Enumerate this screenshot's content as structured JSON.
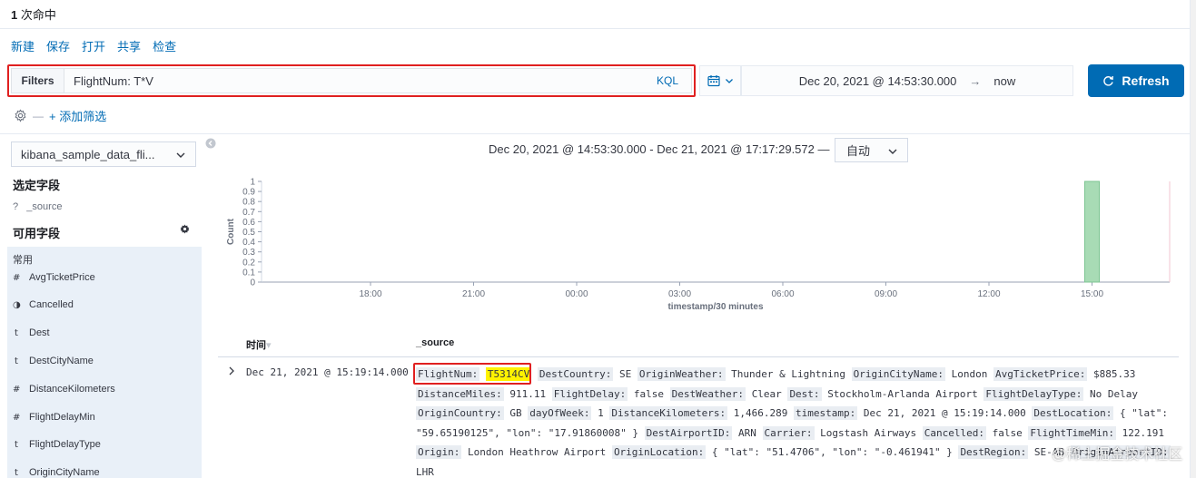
{
  "hits": {
    "count": "1",
    "label": "次命中"
  },
  "menu": {
    "new": "新建",
    "save": "保存",
    "open": "打开",
    "share": "共享",
    "inspect": "检查"
  },
  "query": {
    "filters_label": "Filters",
    "value": "FlightNum: T*V",
    "language": "KQL"
  },
  "time": {
    "start": "Dec 20, 2021 @ 14:53:30.000",
    "end": "now",
    "refresh_label": "Refresh"
  },
  "filter_bar": {
    "dash": "—",
    "add_filter": "+ 添加筛选"
  },
  "sidebar": {
    "index_pattern": "kibana_sample_data_fli...",
    "selected_title": "选定字段",
    "selected_field": {
      "type": "?",
      "name": "_source"
    },
    "available_title": "可用字段",
    "common_label": "常用",
    "fields": [
      {
        "type": "#",
        "name": "AvgTicketPrice"
      },
      {
        "type": "◑",
        "name": "Cancelled"
      },
      {
        "type": "t",
        "name": "Dest"
      },
      {
        "type": "t",
        "name": "DestCityName"
      },
      {
        "type": "#",
        "name": "DistanceKilometers"
      },
      {
        "type": "#",
        "name": "FlightDelayMin"
      },
      {
        "type": "t",
        "name": "FlightDelayType"
      },
      {
        "type": "t",
        "name": "OriginCityName"
      }
    ]
  },
  "histogram": {
    "range_label": "Dec 20, 2021 @ 14:53:30.000 - Dec 21, 2021 @ 17:17:29.572 —",
    "interval": "自动"
  },
  "chart_data": {
    "type": "bar",
    "title": "",
    "xlabel": "timestamp/30 minutes",
    "ylabel": "Count",
    "x_ticks": [
      "18:00",
      "21:00",
      "00:00",
      "03:00",
      "06:00",
      "09:00",
      "12:00",
      "15:00"
    ],
    "y_ticks": [
      "0",
      "0.1",
      "0.2",
      "0.3",
      "0.4",
      "0.5",
      "0.6",
      "0.7",
      "0.8",
      "0.9",
      "1"
    ],
    "ylim": [
      0,
      1
    ],
    "bars": [
      {
        "x": "15:00",
        "value": 1
      }
    ],
    "color": "#a8dbb5"
  },
  "table": {
    "time_header": "时间",
    "source_header": "_source",
    "row": {
      "time": "Dec 21, 2021 @ 15:19:14.000",
      "fields": [
        {
          "key": "FlightNum:",
          "value": "T5314CV",
          "highlight": true
        },
        {
          "key": "DestCountry:",
          "value": "SE"
        },
        {
          "key": "OriginWeather:",
          "value": "Thunder & Lightning"
        },
        {
          "key": "OriginCityName:",
          "value": "London"
        },
        {
          "key": "AvgTicketPrice:",
          "value": "$885.33"
        },
        {
          "key": "DistanceMiles:",
          "value": "911.11"
        },
        {
          "key": "FlightDelay:",
          "value": "false"
        },
        {
          "key": "DestWeather:",
          "value": "Clear"
        },
        {
          "key": "Dest:",
          "value": "Stockholm-Arlanda Airport"
        },
        {
          "key": "FlightDelayType:",
          "value": "No Delay"
        },
        {
          "key": "OriginCountry:",
          "value": "GB"
        },
        {
          "key": "dayOfWeek:",
          "value": "1"
        },
        {
          "key": "DistanceKilometers:",
          "value": "1,466.289"
        },
        {
          "key": "timestamp:",
          "value": "Dec 21, 2021 @ 15:19:14.000"
        },
        {
          "key": "DestLocation:",
          "value": "{ \"lat\": \"59.65190125\", \"lon\": \"17.91860008\" }"
        },
        {
          "key": "DestAirportID:",
          "value": "ARN"
        },
        {
          "key": "Carrier:",
          "value": "Logstash Airways"
        },
        {
          "key": "Cancelled:",
          "value": "false"
        },
        {
          "key": "FlightTimeMin:",
          "value": "122.191"
        },
        {
          "key": "Origin:",
          "value": "London Heathrow Airport"
        },
        {
          "key": "OriginLocation:",
          "value": "{ \"lat\": \"51.4706\", \"lon\": \"-0.461941\" }"
        },
        {
          "key": "DestRegion:",
          "value": "SE-AB"
        },
        {
          "key": "OriginAirportID:",
          "value": "LHR"
        }
      ]
    }
  },
  "watermark": "@稀土掘金技术社区"
}
